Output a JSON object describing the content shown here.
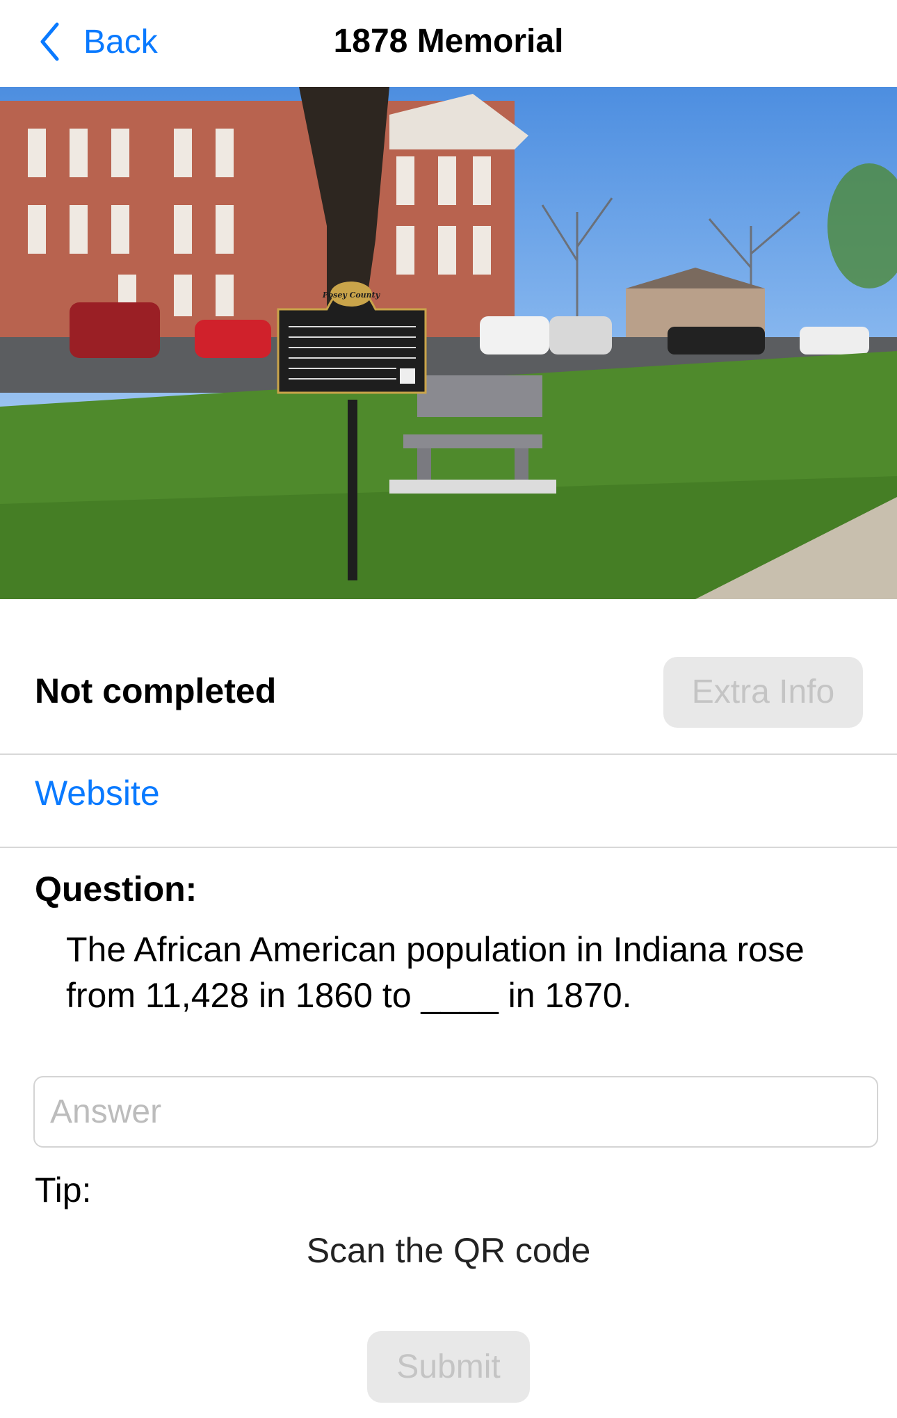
{
  "nav": {
    "back_label": "Back",
    "title": "1878 Memorial"
  },
  "photo": {
    "alt_subject": "Posey County"
  },
  "status": {
    "label": "Not completed",
    "extra_info_label": "Extra Info"
  },
  "links": {
    "website_label": "Website"
  },
  "question": {
    "label": "Question:",
    "text": "The African American population in Indiana rose from 11,428 in 1860 to ____ in 1870."
  },
  "answer": {
    "placeholder": "Answer",
    "value": ""
  },
  "tip": {
    "label": "Tip:",
    "text": "Scan the QR code"
  },
  "actions": {
    "submit_label": "Submit"
  },
  "colors": {
    "accent": "#0a7aff",
    "disabled_bg": "#e8e8e8",
    "disabled_text": "#c4c4c4"
  }
}
